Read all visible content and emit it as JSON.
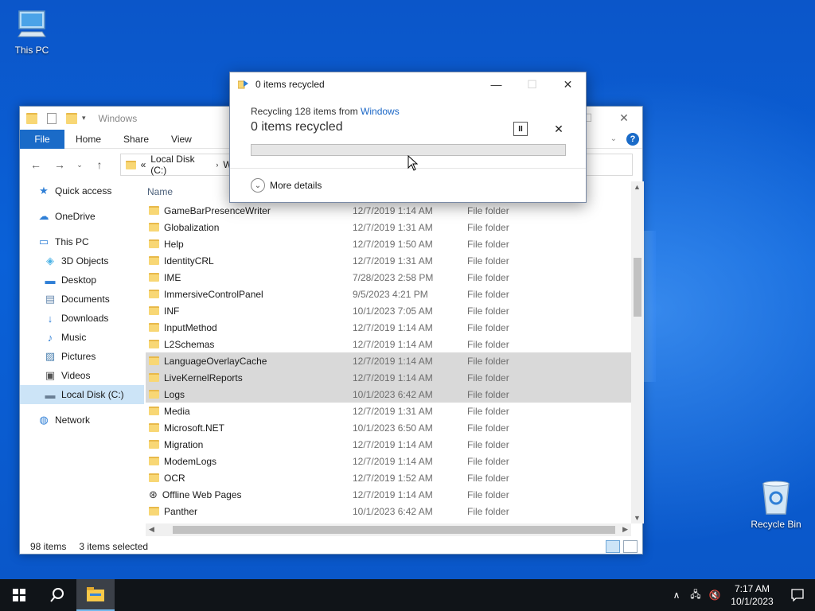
{
  "desktop": {
    "icons": [
      {
        "label": "This PC",
        "icon": "monitor-icon"
      },
      {
        "label": "Recycle Bin",
        "icon": "recycle-bin-icon"
      }
    ]
  },
  "explorer": {
    "title": "Windows",
    "ribbon": {
      "file": "File",
      "home": "Home",
      "share": "Share",
      "view": "View"
    },
    "address": {
      "prefix": "«",
      "drive": "Local Disk (C:)",
      "folder": "Win"
    },
    "sidebar": [
      {
        "label": "Quick access",
        "icon": "star-icon",
        "level": 0
      },
      {
        "label": "OneDrive",
        "icon": "cloud-icon",
        "level": 0
      },
      {
        "label": "This PC",
        "icon": "monitor-icon",
        "level": 0
      },
      {
        "label": "3D Objects",
        "icon": "cube-icon",
        "level": 1
      },
      {
        "label": "Desktop",
        "icon": "desktop-icon",
        "level": 1
      },
      {
        "label": "Documents",
        "icon": "documents-icon",
        "level": 1
      },
      {
        "label": "Downloads",
        "icon": "download-icon",
        "level": 1
      },
      {
        "label": "Music",
        "icon": "music-icon",
        "level": 1
      },
      {
        "label": "Pictures",
        "icon": "pictures-icon",
        "level": 1
      },
      {
        "label": "Videos",
        "icon": "videos-icon",
        "level": 1
      },
      {
        "label": "Local Disk (C:)",
        "icon": "drive-icon",
        "level": 1,
        "selected": true
      },
      {
        "label": "Network",
        "icon": "network-icon",
        "level": 0
      }
    ],
    "columns": {
      "name": "Name"
    },
    "rows": [
      {
        "name": "GameBarPresenceWriter",
        "date": "12/7/2019 1:14 AM",
        "type": "File folder"
      },
      {
        "name": "Globalization",
        "date": "12/7/2019 1:31 AM",
        "type": "File folder"
      },
      {
        "name": "Help",
        "date": "12/7/2019 1:50 AM",
        "type": "File folder"
      },
      {
        "name": "IdentityCRL",
        "date": "12/7/2019 1:31 AM",
        "type": "File folder"
      },
      {
        "name": "IME",
        "date": "7/28/2023 2:58 PM",
        "type": "File folder"
      },
      {
        "name": "ImmersiveControlPanel",
        "date": "9/5/2023 4:21 PM",
        "type": "File folder"
      },
      {
        "name": "INF",
        "date": "10/1/2023 7:05 AM",
        "type": "File folder"
      },
      {
        "name": "InputMethod",
        "date": "12/7/2019 1:14 AM",
        "type": "File folder"
      },
      {
        "name": "L2Schemas",
        "date": "12/7/2019 1:14 AM",
        "type": "File folder"
      },
      {
        "name": "LanguageOverlayCache",
        "date": "12/7/2019 1:14 AM",
        "type": "File folder",
        "selected": true
      },
      {
        "name": "LiveKernelReports",
        "date": "12/7/2019 1:14 AM",
        "type": "File folder",
        "selected": true
      },
      {
        "name": "Logs",
        "date": "10/1/2023 6:42 AM",
        "type": "File folder",
        "selected": true
      },
      {
        "name": "Media",
        "date": "12/7/2019 1:31 AM",
        "type": "File folder"
      },
      {
        "name": "Microsoft.NET",
        "date": "10/1/2023 6:50 AM",
        "type": "File folder"
      },
      {
        "name": "Migration",
        "date": "12/7/2019 1:14 AM",
        "type": "File folder"
      },
      {
        "name": "ModemLogs",
        "date": "12/7/2019 1:14 AM",
        "type": "File folder"
      },
      {
        "name": "OCR",
        "date": "12/7/2019 1:52 AM",
        "type": "File folder"
      },
      {
        "name": "Offline Web Pages",
        "date": "12/7/2019 1:14 AM",
        "type": "File folder",
        "special_icon": "web-pages-icon"
      },
      {
        "name": "Panther",
        "date": "10/1/2023 6:42 AM",
        "type": "File folder"
      }
    ],
    "status": {
      "items": "98 items",
      "selected": "3 items selected"
    }
  },
  "dialog": {
    "title": "0 items recycled",
    "line1_prefix": "Recycling 128 items from ",
    "line1_link": "Windows",
    "line2": "0 items recycled",
    "progress_fraction": 0,
    "more_details": "More details"
  },
  "taskbar": {
    "time": "7:17 AM",
    "date": "10/1/2023"
  },
  "colors": {
    "accent": "#1a6bc8",
    "selection": "#d9d9d9",
    "progress_fill": "#06b025"
  }
}
